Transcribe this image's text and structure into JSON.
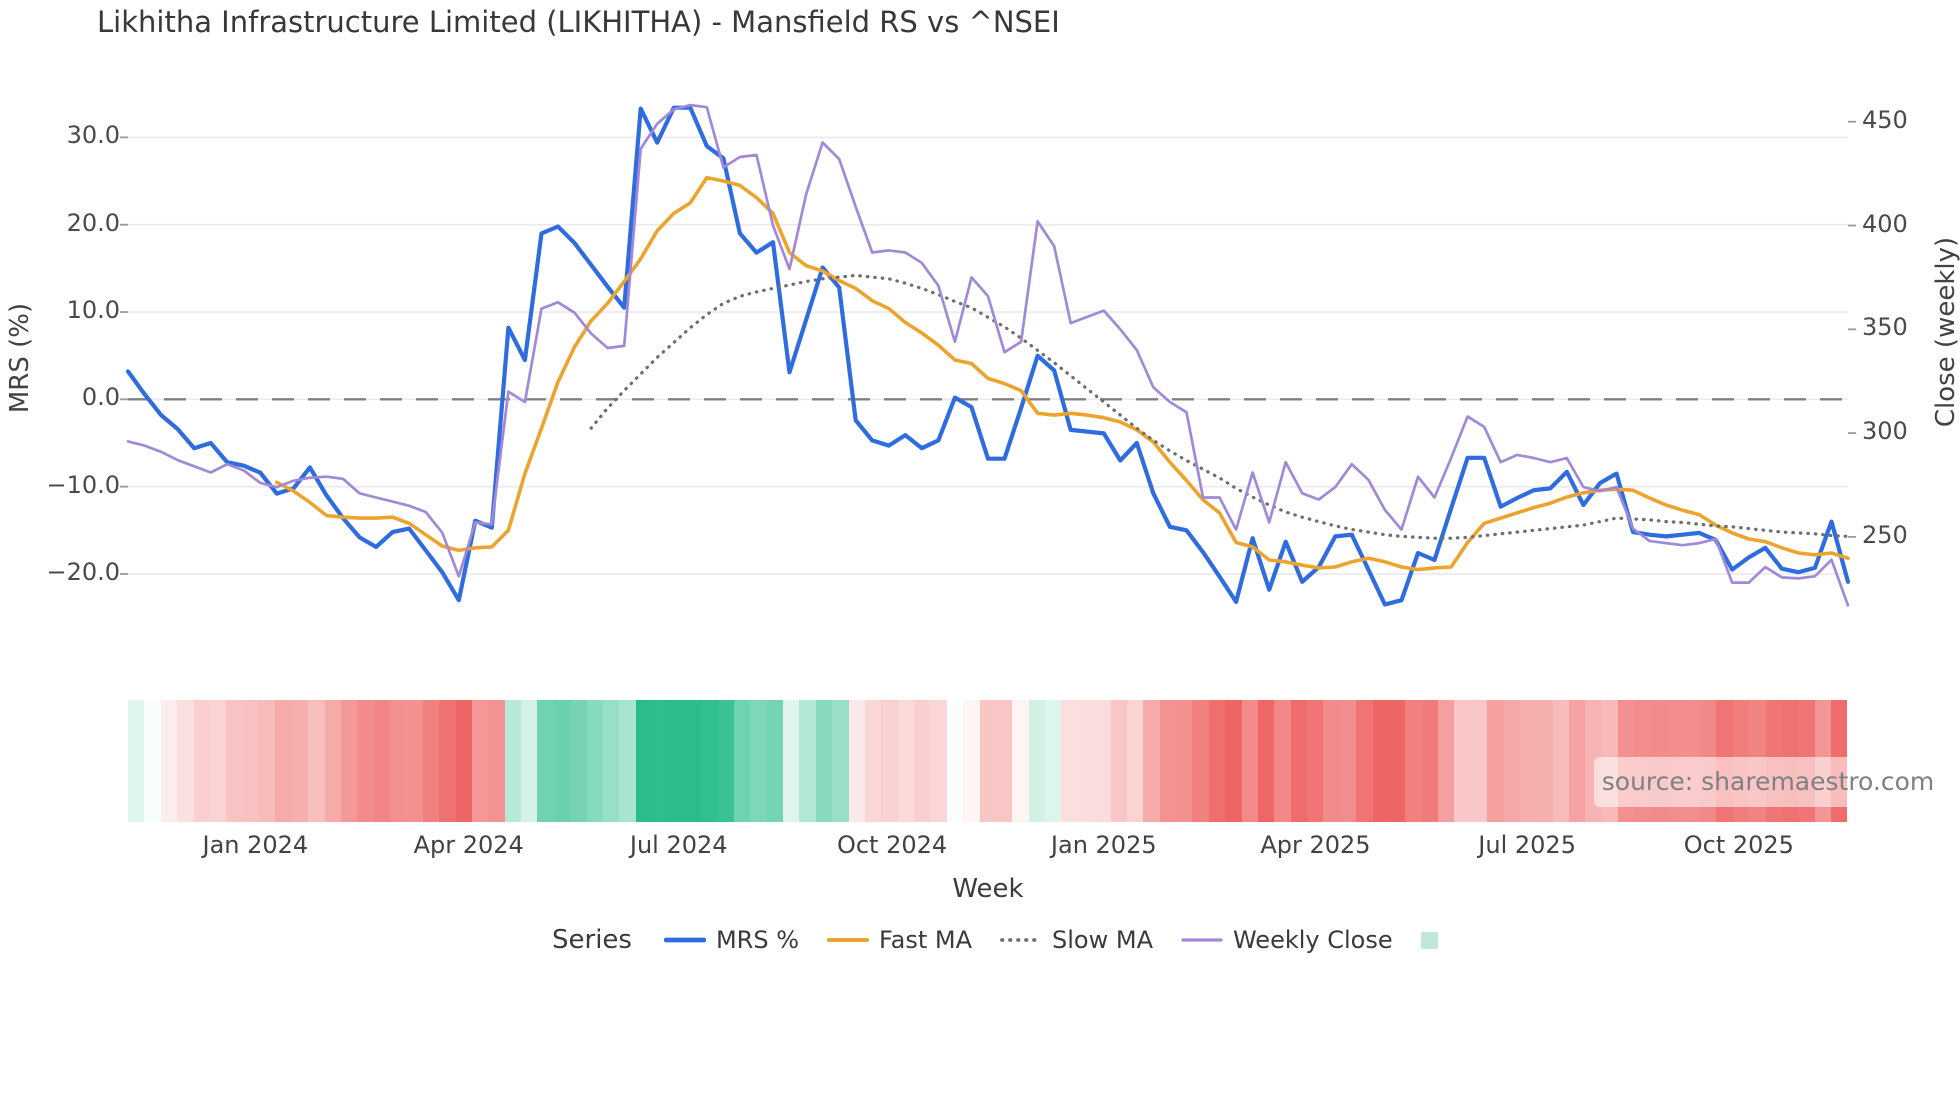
{
  "title": "Likhitha Infrastructure Limited (LIKHITHA) - Mansfield RS vs ^NSEI",
  "watermark": "source: sharemaestro.com",
  "axes": {
    "left_label": "MRS (%)",
    "right_label": "Close (weekly)",
    "x_label": "Week",
    "left_ticks": [
      {
        "label": "30.0",
        "value": 30
      },
      {
        "label": "20.0",
        "value": 20
      },
      {
        "label": "10.0",
        "value": 10
      },
      {
        "label": "0.0",
        "value": 0
      },
      {
        "label": "−10.0",
        "value": -10
      },
      {
        "label": "−20.0",
        "value": -20
      }
    ],
    "right_ticks": [
      {
        "label": "450",
        "value": 450
      },
      {
        "label": "400",
        "value": 400
      },
      {
        "label": "350",
        "value": 350
      },
      {
        "label": "300",
        "value": 300
      },
      {
        "label": "250",
        "value": 250
      }
    ],
    "x_ticks": [
      {
        "label": "Jan 2024",
        "week": 7.7
      },
      {
        "label": "Apr 2024",
        "week": 20.6
      },
      {
        "label": "Jul 2024",
        "week": 33.3
      },
      {
        "label": "Oct 2024",
        "week": 46.2
      },
      {
        "label": "Jan 2025",
        "week": 59.0
      },
      {
        "label": "Apr 2025",
        "week": 71.8
      },
      {
        "label": "Jul 2025",
        "week": 84.6
      },
      {
        "label": "Oct 2025",
        "week": 97.4
      }
    ]
  },
  "legend": {
    "title": "Series",
    "swatch_color": "#bfe9d7"
  },
  "colors": {
    "grid": "#e9e9f0",
    "zero_line": "#808080",
    "tick_mark": "#9a9a9a",
    "heat_pos": "#2abd8a",
    "heat_neg": "#ee6565"
  },
  "chart_data": {
    "type": "line",
    "x_unit": "week_index",
    "n": 105,
    "x_range_weeks": [
      "Nov 2023",
      "Nov 2025"
    ],
    "ylim_left": [
      -25.5,
      36.0
    ],
    "ylim_right": [
      209.0,
      467.7
    ],
    "zero_reference_line_left": 0,
    "grid": true,
    "legend_position": "bottom",
    "heatmap": {
      "source_series": "MRS %",
      "pos_max": 30,
      "neg_max": 22,
      "gamma": 0.85
    },
    "series": [
      {
        "name": "MRS %",
        "axis": "left",
        "color": "#2e6ce0",
        "style": "solid",
        "width": 4.2,
        "values": [
          3.2,
          0.6,
          -1.8,
          -3.4,
          -5.6,
          -5.0,
          -7.2,
          -7.6,
          -8.4,
          -10.8,
          -10.2,
          -7.8,
          -11.0,
          -13.6,
          -15.8,
          -16.9,
          -15.2,
          -14.8,
          -17.3,
          -19.8,
          -23.0,
          -13.9,
          -14.7,
          8.2,
          4.5,
          19.0,
          19.8,
          17.9,
          15.4,
          12.9,
          10.5,
          33.3,
          29.4,
          33.4,
          33.4,
          29.0,
          27.6,
          19.0,
          16.8,
          18.0,
          3.1,
          9.1,
          15.1,
          12.8,
          -2.4,
          -4.7,
          -5.3,
          -4.1,
          -5.6,
          -4.7,
          0.2,
          -0.9,
          -6.8,
          -6.8,
          -1.0,
          5.0,
          3.3,
          -3.5,
          -3.7,
          -3.9,
          -7.0,
          -5.0,
          -10.8,
          -14.6,
          -15.0,
          -17.5,
          -20.3,
          -23.2,
          -15.9,
          -21.8,
          -16.3,
          -20.9,
          -19.2,
          -15.7,
          -15.5,
          -19.5,
          -23.5,
          -23.0,
          -17.6,
          -18.4,
          -12.5,
          -6.7,
          -6.7,
          -12.3,
          -11.3,
          -10.4,
          -10.2,
          -8.3,
          -12.1,
          -9.6,
          -8.5,
          -15.2,
          -15.5,
          -15.7,
          -15.5,
          -15.3,
          -16.1,
          -19.5,
          -18.1,
          -17.0,
          -19.4,
          -19.8,
          -19.3,
          -14.0,
          -20.9
        ]
      },
      {
        "name": "Fast MA",
        "axis": "left",
        "color": "#eda42e",
        "style": "solid",
        "width": 3.6,
        "values": [
          null,
          null,
          null,
          null,
          null,
          null,
          null,
          null,
          null,
          -9.5,
          -10.5,
          -11.8,
          -13.3,
          -13.5,
          -13.6,
          -13.6,
          -13.5,
          -14.2,
          -15.5,
          -16.8,
          -17.3,
          -17.0,
          -16.9,
          -15.0,
          -8.5,
          -3.3,
          2.0,
          6.0,
          9.0,
          11.0,
          13.5,
          16.1,
          19.3,
          21.3,
          22.5,
          25.4,
          25.0,
          24.5,
          23.1,
          21.3,
          16.8,
          15.3,
          14.7,
          13.6,
          12.7,
          11.3,
          10.4,
          8.8,
          7.6,
          6.2,
          4.5,
          4.1,
          2.4,
          1.8,
          1.0,
          -1.6,
          -1.8,
          -1.6,
          -1.8,
          -2.1,
          -2.6,
          -3.5,
          -4.9,
          -7.2,
          -9.3,
          -11.5,
          -13.0,
          -16.4,
          -16.9,
          -18.4,
          -18.6,
          -19.0,
          -19.3,
          -19.2,
          -18.6,
          -18.2,
          -18.6,
          -19.2,
          -19.5,
          -19.3,
          -19.2,
          -16.4,
          -14.2,
          -13.6,
          -13.0,
          -12.4,
          -11.9,
          -11.2,
          -10.7,
          -10.4,
          -10.3,
          -10.4,
          -11.3,
          -12.1,
          -12.7,
          -13.2,
          -14.4,
          -15.3,
          -16.0,
          -16.3,
          -17.0,
          -17.6,
          -17.8,
          -17.6,
          -18.2
        ]
      },
      {
        "name": "Slow MA",
        "axis": "left",
        "color": "#6e6e6e",
        "style": "dotted",
        "width": 3.2,
        "values": [
          null,
          null,
          null,
          null,
          null,
          null,
          null,
          null,
          null,
          null,
          null,
          null,
          null,
          null,
          null,
          null,
          null,
          null,
          null,
          null,
          null,
          null,
          null,
          null,
          null,
          null,
          null,
          null,
          -3.3,
          -1.0,
          1.0,
          2.9,
          4.8,
          6.5,
          8.2,
          9.7,
          11.0,
          11.8,
          12.3,
          12.7,
          13.1,
          13.5,
          13.8,
          14.0,
          14.2,
          14.0,
          13.8,
          13.3,
          12.7,
          12.0,
          11.2,
          10.5,
          9.4,
          8.3,
          7.0,
          5.6,
          4.2,
          2.7,
          1.2,
          -0.3,
          -1.8,
          -3.3,
          -4.7,
          -5.9,
          -7.0,
          -8.0,
          -9.0,
          -10.2,
          -11.2,
          -12.1,
          -12.9,
          -13.5,
          -14.0,
          -14.5,
          -14.9,
          -15.2,
          -15.5,
          -15.7,
          -15.8,
          -15.9,
          -15.9,
          -15.8,
          -15.6,
          -15.4,
          -15.2,
          -15.0,
          -14.8,
          -14.6,
          -14.4,
          -14.0,
          -13.6,
          -13.7,
          -13.8,
          -14.0,
          -14.1,
          -14.3,
          -14.5,
          -14.6,
          -14.8,
          -15.0,
          -15.2,
          -15.3,
          -15.4,
          -15.6,
          -15.7
        ]
      },
      {
        "name": "Weekly Close",
        "axis": "right",
        "color": "#a289d8",
        "style": "solid",
        "width": 2.7,
        "values": [
          296,
          294,
          291,
          287,
          284,
          281,
          285,
          282,
          276,
          274,
          277,
          278.5,
          279,
          278,
          271,
          269,
          267,
          265,
          262,
          252,
          231,
          257,
          256,
          320,
          315,
          360,
          363,
          358,
          348,
          341,
          342,
          437,
          449,
          456,
          458,
          457,
          428,
          433,
          434,
          400,
          379,
          415,
          440,
          432,
          409,
          387,
          388,
          387,
          382,
          371,
          344,
          375,
          366,
          339,
          344,
          402,
          390,
          353,
          356,
          359,
          350,
          340,
          322,
          315,
          310,
          269,
          269,
          253.5,
          281,
          257,
          286,
          271,
          268,
          274,
          285,
          277.5,
          263,
          253.5,
          279,
          269,
          288,
          308,
          303,
          286,
          289.5,
          288,
          286,
          288,
          274,
          272,
          274,
          254,
          248,
          247,
          246,
          247,
          249,
          228,
          228,
          235.5,
          230.5,
          230,
          231,
          239,
          217
        ]
      }
    ]
  }
}
